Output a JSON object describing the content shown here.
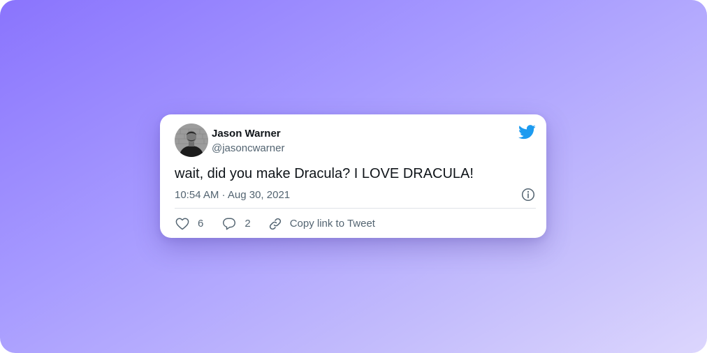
{
  "tweet": {
    "author_name": "Jason Warner",
    "author_handle": "@jasoncwarner",
    "text": "wait, did you make Dracula? I LOVE DRACULA!",
    "timestamp": "10:54 AM · Aug 30, 2021",
    "likes": "6",
    "replies": "2",
    "copy_link_label": "Copy link to Tweet"
  },
  "icons": {
    "brand": "twitter-bird-icon",
    "info": "info-icon",
    "like": "heart-icon",
    "reply": "speech-bubble-icon",
    "copy_link": "link-icon"
  },
  "colors": {
    "twitter_blue": "#1d9bf0",
    "text_primary": "#0f1419",
    "text_secondary": "#536471",
    "background_gradient_start": "#8a74fd",
    "background_gradient_end": "#dcd6fd"
  }
}
